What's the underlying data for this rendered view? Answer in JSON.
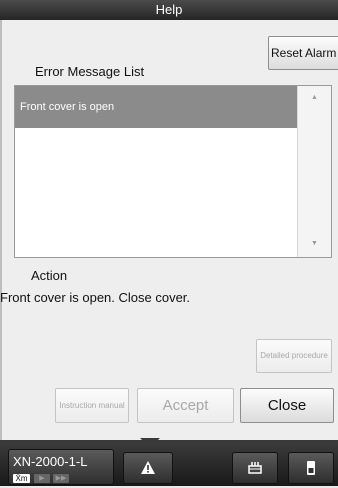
{
  "window": {
    "title": "Help"
  },
  "error_list": {
    "label": "Error Message List",
    "items": [
      "Front cover is open"
    ],
    "reset_button": "Reset Alarm"
  },
  "action": {
    "label": "Action",
    "text": "Front cover is open. Close cover."
  },
  "buttons": {
    "detailed_procedure": "Detailed procedure",
    "instruction_manual": "Instruction manual",
    "accept": "Accept",
    "close": "Close"
  },
  "taskbar": {
    "device_name": "XN-2000-1-L",
    "mode": "X̄m",
    "icons": [
      "warning-icon",
      "rack-icon",
      "reagent-icon"
    ]
  }
}
